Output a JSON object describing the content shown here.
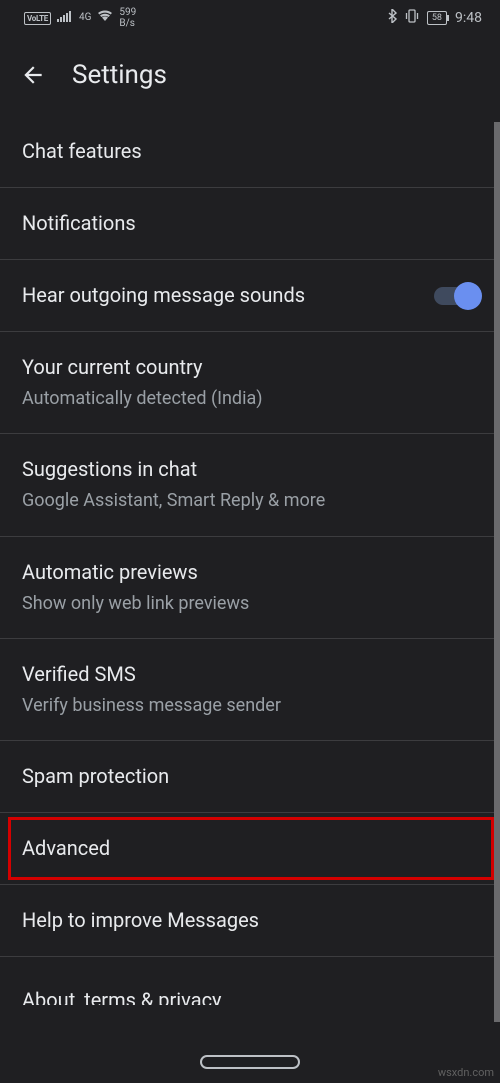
{
  "status": {
    "volte": "VoLTE",
    "network_gen": "4G",
    "net_speed_top": "599",
    "net_speed_bottom": "B/s",
    "battery": "58",
    "time": "9:48"
  },
  "header": {
    "title": "Settings"
  },
  "items": {
    "chat_features": "Chat features",
    "notifications": "Notifications",
    "hear_sounds": "Hear outgoing message sounds",
    "country_title": "Your current country",
    "country_sub": "Automatically detected (India)",
    "suggestions_title": "Suggestions in chat",
    "suggestions_sub": "Google Assistant, Smart Reply & more",
    "previews_title": "Automatic previews",
    "previews_sub": "Show only web link previews",
    "verified_title": "Verified SMS",
    "verified_sub": "Verify business message sender",
    "spam": "Spam protection",
    "advanced": "Advanced",
    "help_improve": "Help to improve Messages",
    "about": "About, terms & privacy"
  },
  "watermark": "wsxdn.com"
}
